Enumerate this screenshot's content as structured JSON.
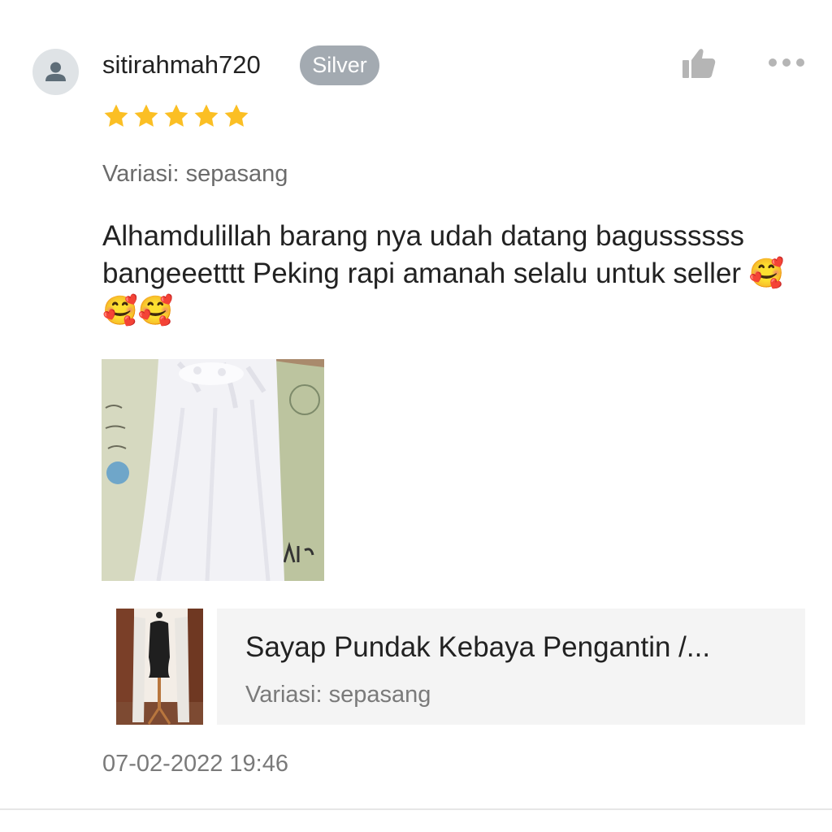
{
  "review": {
    "username": "sitirahmah720",
    "badge": "Silver",
    "rating": 5,
    "variation": "Variasi: sepasang",
    "text": "Alhamdulillah barang nya udah datang bagussssss bangeeetttt Peking rapi amanah selalu untuk seller 🥰🥰🥰",
    "timestamp": "07-02-2022 19:46"
  },
  "product": {
    "title": "Sayap Pundak Kebaya Pengantin /...",
    "variation": "Variasi: sepasang"
  },
  "icons": {
    "avatar": "user-avatar-icon",
    "like": "thumbs-up-icon",
    "more": "more-options-icon",
    "star": "star-icon"
  },
  "colors": {
    "badge_bg": "#a3aab1",
    "star": "#fbbf24",
    "icon_gray": "#b5b5b5",
    "card_bg": "#f4f4f4"
  }
}
